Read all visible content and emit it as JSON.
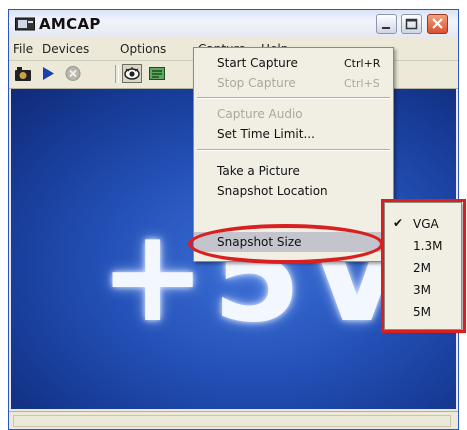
{
  "window": {
    "title": "AMCAP"
  },
  "menubar": [
    "File",
    "Devices",
    "Options",
    "Capture",
    "Help"
  ],
  "video": {
    "overlay_text": "+5V"
  },
  "capture_menu": {
    "items": [
      {
        "label": "Start Capture",
        "shortcut": "Ctrl+R",
        "enabled": true
      },
      {
        "label": "Stop Capture",
        "shortcut": "Ctrl+S",
        "enabled": false
      },
      {
        "label": "Capture Audio",
        "enabled": false
      },
      {
        "label": "Set Time Limit...",
        "enabled": true
      },
      {
        "label": "Take a Picture",
        "enabled": true
      },
      {
        "label": "Snapshot Location",
        "enabled": true
      },
      {
        "label": "Snapshot Size",
        "enabled": true,
        "highlighted": true,
        "submenu": true
      }
    ]
  },
  "snapshot_size_submenu": {
    "options": [
      "VGA",
      "1.3M",
      "2M",
      "3M",
      "5M"
    ],
    "checked": "VGA"
  },
  "toolbar_icons": [
    "camera-icon",
    "play-icon",
    "stop-icon",
    "preview-eye-icon",
    "overlay-icon"
  ],
  "annotation_color": "#d92020"
}
